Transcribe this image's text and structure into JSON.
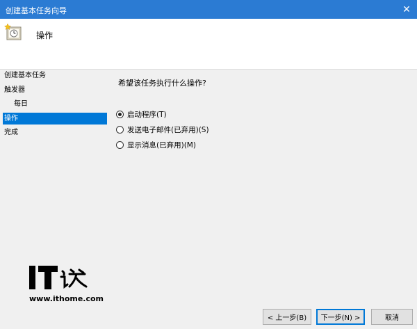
{
  "window": {
    "title": "创建基本任务向导",
    "close_glyph": "✕"
  },
  "header": {
    "title": "操作",
    "icon": "task-scheduler-clock-icon"
  },
  "steps": [
    {
      "label": "创建基本任务",
      "sub": false,
      "active": false
    },
    {
      "label": "触发器",
      "sub": false,
      "active": false
    },
    {
      "label": "每日",
      "sub": true,
      "active": false
    },
    {
      "label": "操作",
      "sub": false,
      "active": true
    },
    {
      "label": "完成",
      "sub": false,
      "active": false
    }
  ],
  "content": {
    "question": "希望该任务执行什么操作?",
    "options": [
      {
        "label": "启动程序(T)",
        "checked": true
      },
      {
        "label": "发送电子邮件(已弃用)(S)",
        "checked": false
      },
      {
        "label": "显示消息(已弃用)(M)",
        "checked": false
      }
    ]
  },
  "watermark": {
    "url": "www.ithome.com"
  },
  "buttons": {
    "back": "< 上一步(B)",
    "next": "下一步(N) >",
    "cancel": "取消"
  },
  "colors": {
    "titlebar": "#2b7bd3",
    "selection": "#0078d7",
    "background": "#f0f0f0"
  }
}
